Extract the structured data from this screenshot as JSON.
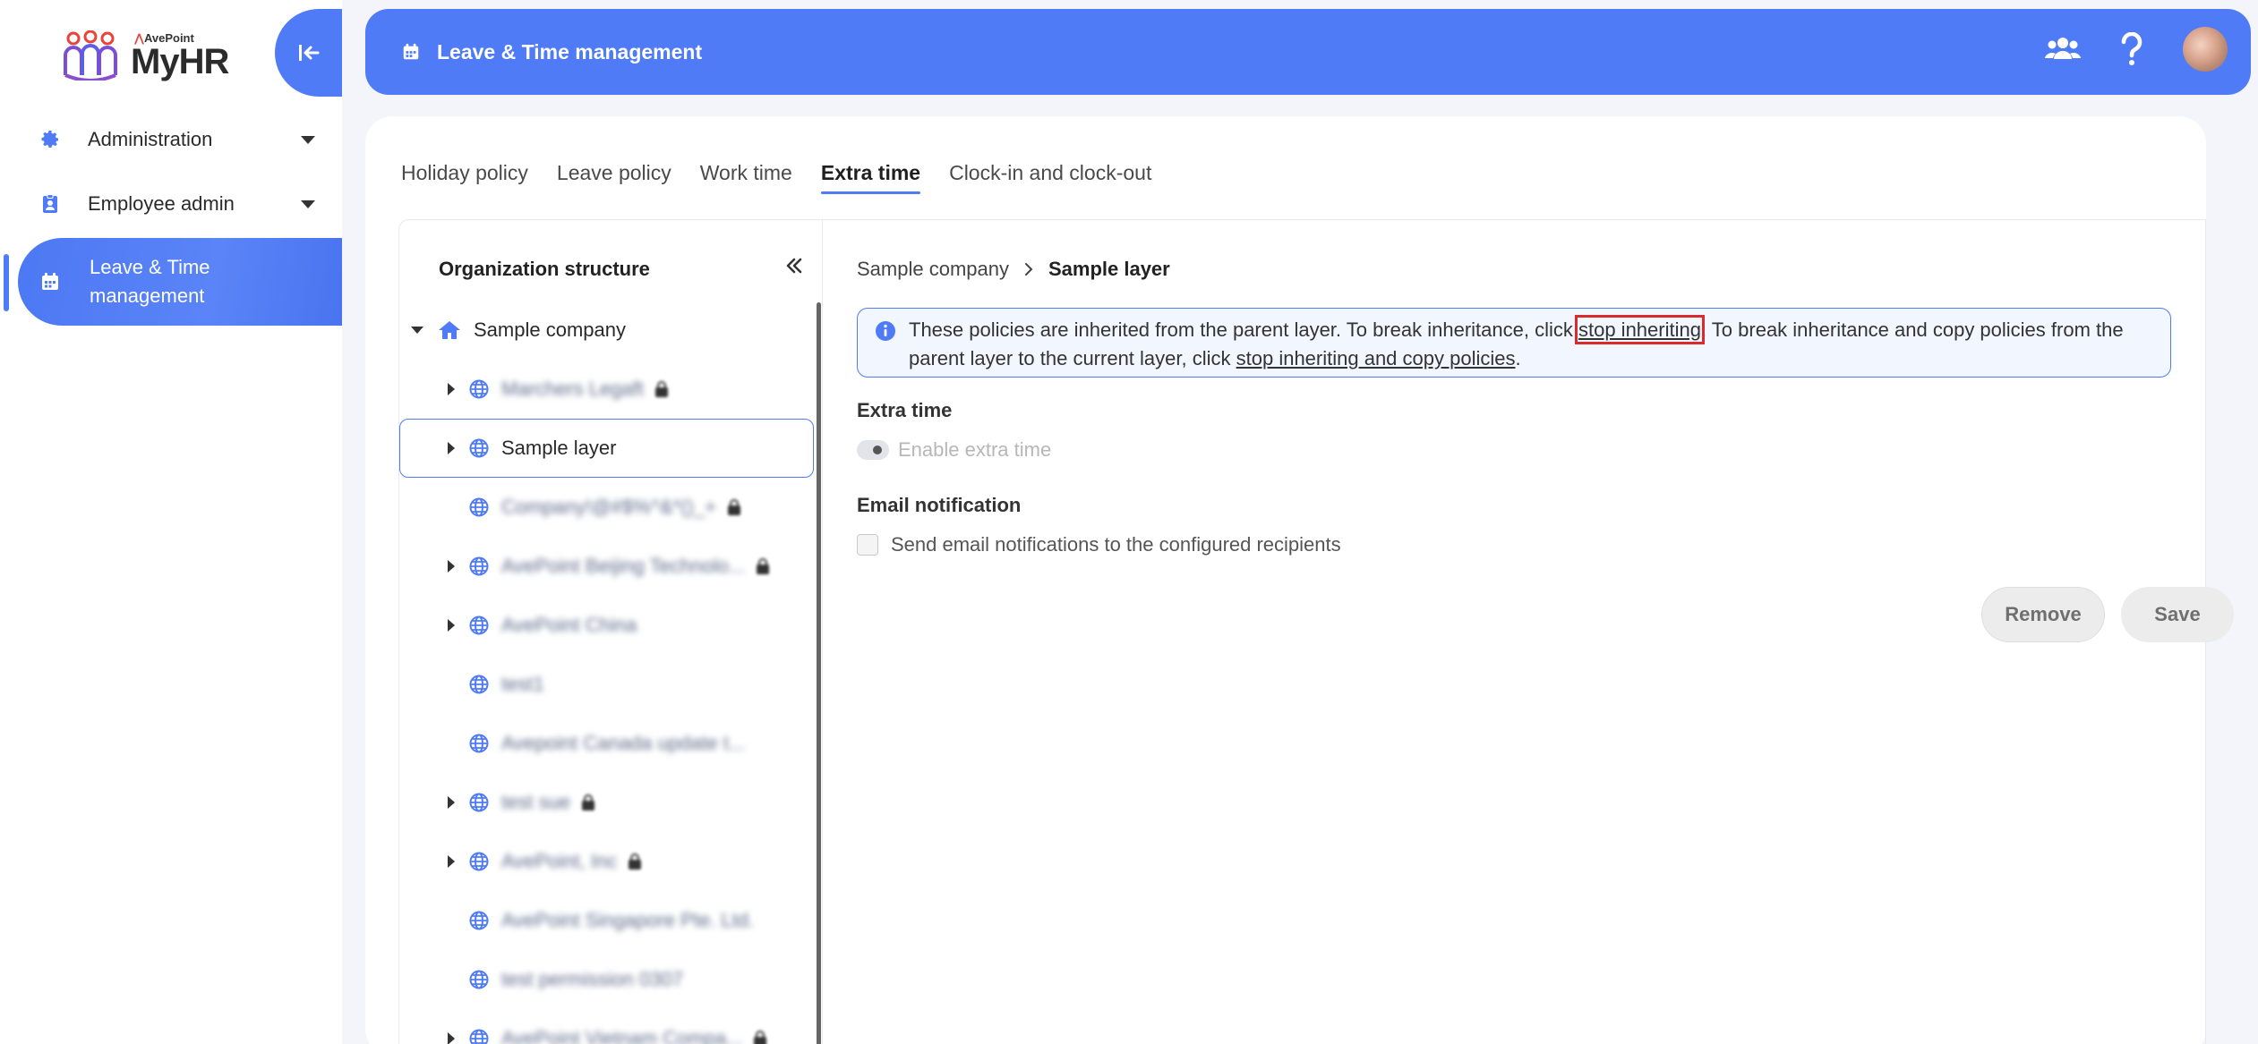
{
  "brand": {
    "sub": "AvePoint",
    "name": "MyHR"
  },
  "sidebar": {
    "items": [
      {
        "label": "Administration",
        "icon": "gear-icon"
      },
      {
        "label": "Employee admin",
        "icon": "badge-icon"
      },
      {
        "label": "Leave & Time management",
        "icon": "calendar-icon"
      }
    ]
  },
  "header": {
    "title": "Leave & Time management"
  },
  "tabs": [
    "Holiday policy",
    "Leave policy",
    "Work time",
    "Extra time",
    "Clock-in and clock-out"
  ],
  "org": {
    "title": "Organization structure",
    "root": "Sample company",
    "nodes": [
      "Marchers Legaft",
      "Sample layer",
      "Company!@#$%^&*()_+",
      "AvePoint Beijing Technolo...",
      "AvePoint China",
      "test1",
      "Avepoint Canada update t...",
      "test sue",
      "AvePoint, Inc",
      "AvePoint Singapore Pte. Ltd.",
      "test permission 0307",
      "AvePoint Vietnam Compa..."
    ]
  },
  "detail": {
    "breadcrumb": [
      "Sample company",
      "Sample layer"
    ],
    "info": {
      "part1": "These policies are inherited from the parent layer. To break inheritance, click ",
      "link1": "stop inheriting",
      "part2": ". To break inheritance and copy policies from the parent layer to the current layer, click ",
      "link2": "stop inheriting and copy policies",
      "part3": "."
    },
    "extra_time": {
      "heading": "Extra time",
      "toggle_label": "Enable extra time"
    },
    "email": {
      "heading": "Email notification",
      "checkbox_label": "Send email notifications to the configured recipients"
    },
    "buttons": {
      "remove": "Remove",
      "save": "Save"
    }
  },
  "colors": {
    "primary": "#4f7bf7",
    "highlight": "#d92b2b"
  }
}
